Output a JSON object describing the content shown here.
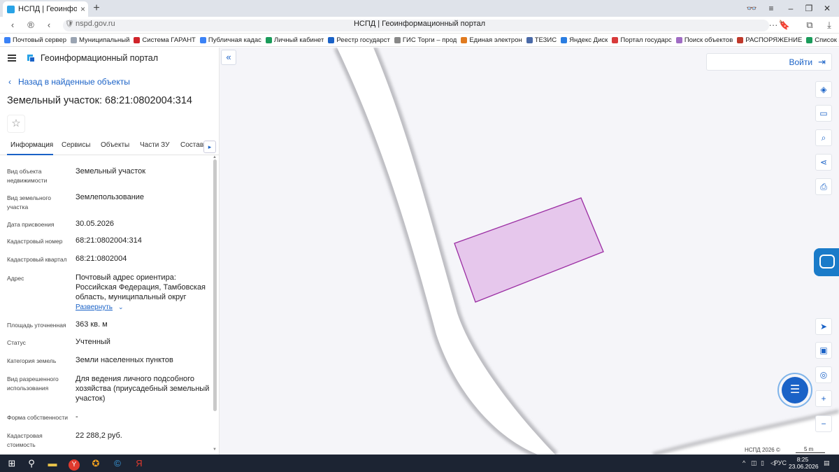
{
  "browser": {
    "tab_title": "НСПД | Геоинформаци",
    "url_host": "nspd.gov.ru",
    "page_title": "НСПД | Геоинформационный портал",
    "bookmarks": [
      {
        "label": "Почтовый сервер",
        "color": "#3b82f6"
      },
      {
        "label": "Муниципальный",
        "color": "#9aa4b2"
      },
      {
        "label": "Система ГАРАНТ",
        "color": "#d0242a"
      },
      {
        "label": "Публичная кадас",
        "color": "#3b82f6"
      },
      {
        "label": "Личный кабинет",
        "color": "#1a9b5a"
      },
      {
        "label": "Реестр государст",
        "color": "#1a62c7"
      },
      {
        "label": "ГИС Торги – прод",
        "color": "#888888"
      },
      {
        "label": "Единая электрон",
        "color": "#e07a1f"
      },
      {
        "label": "ТЕЗИС",
        "color": "#4a6aa8"
      },
      {
        "label": "Яндекс Диск",
        "color": "#2a7de1"
      },
      {
        "label": "Портал государс",
        "color": "#d83a3a"
      },
      {
        "label": "Поиск объектов",
        "color": "#a06cc4"
      },
      {
        "label": "РАСПОРЯЖЕНИЕ",
        "color": "#c0392b"
      },
      {
        "label": "Список заявок",
        "color": "#1a9b5a"
      }
    ]
  },
  "panel": {
    "portal_title": "Геоинформационный портал",
    "back_label": "Назад в найденные объекты",
    "object_title": "Земельный участок: 68:21:0802004:314",
    "star_glyph": "☆",
    "tabs": [
      "Информация",
      "Сервисы",
      "Объекты",
      "Части ЗУ",
      "Состав"
    ],
    "tab_next": "▸",
    "expand_label": "Развернуть",
    "fields": [
      {
        "label": "Вид объекта недвижимости",
        "value": "Земельный участок"
      },
      {
        "label": "Вид земельного участка",
        "value": "Землепользование"
      },
      {
        "label": "Дата присвоения",
        "value": "30.05.2026"
      },
      {
        "label": "Кадастровый номер",
        "value": "68:21:0802004:314"
      },
      {
        "label": "Кадастровый квартал",
        "value": "68:21:0802004"
      },
      {
        "label": "Адрес",
        "value": "Почтовый адрес ориентира: Российская Федерация, Тамбовская область, муниципальный округ"
      },
      {
        "label": "Площадь уточненная",
        "value": "363 кв. м"
      },
      {
        "label": "Статус",
        "value": "Учтенный"
      },
      {
        "label": "Категория земель",
        "value": "Земли населенных пунктов"
      },
      {
        "label": "Вид разрешенного использования",
        "value": "Для ведения личного подсобного хозяйства (приусадебный земельный участок)"
      },
      {
        "label": "Форма собственности",
        "value": "-"
      },
      {
        "label": "Кадастровая стоимость",
        "value": "22 288,2 руб."
      }
    ]
  },
  "map": {
    "login_label": "Войти",
    "attribution": "НСПД 2026 ©",
    "scale_label": "5 m",
    "parcel_fill": "#e6c7ec",
    "parcel_stroke": "#9b2ea3",
    "accent": "#1a62c7"
  },
  "taskbar": {
    "lang": "РУС",
    "time": "8:25",
    "date": "23.06.2026"
  }
}
